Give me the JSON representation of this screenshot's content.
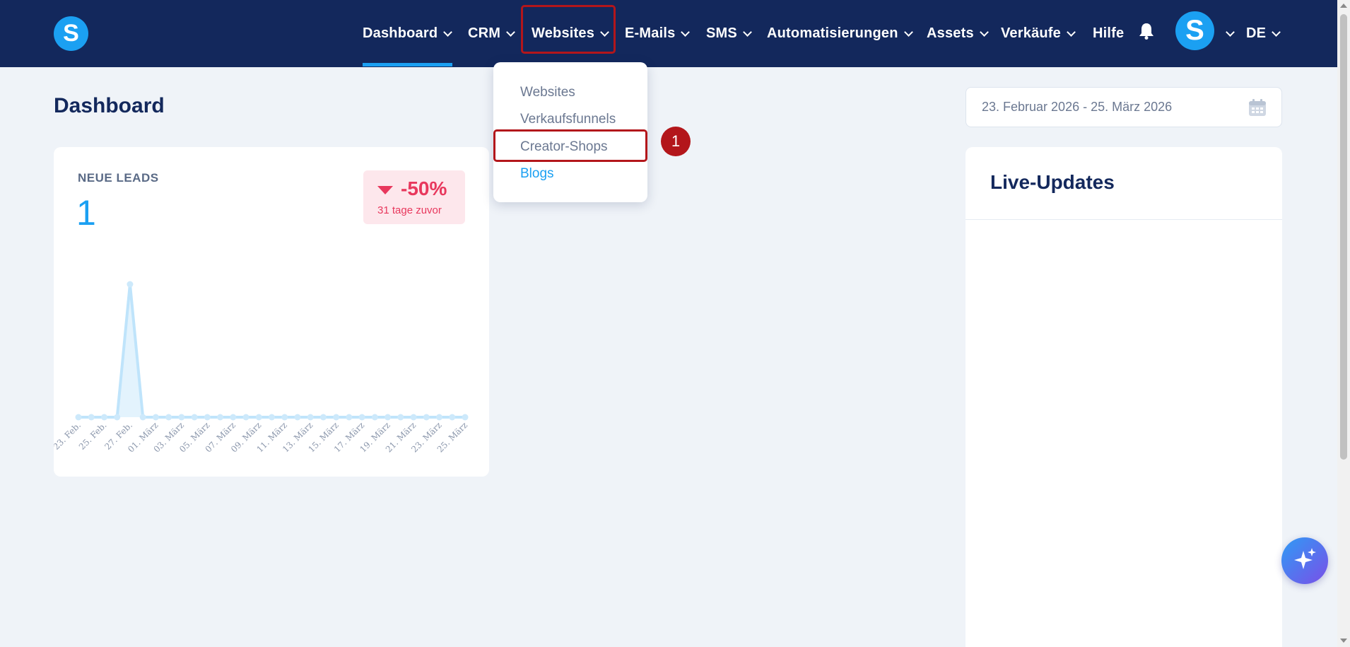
{
  "nav": {
    "logo_letter": "S",
    "items": [
      {
        "label": "Dashboard",
        "has_menu": true
      },
      {
        "label": "CRM",
        "has_menu": true
      },
      {
        "label": "Websites",
        "has_menu": true
      },
      {
        "label": "E-Mails",
        "has_menu": true
      },
      {
        "label": "SMS",
        "has_menu": true
      },
      {
        "label": "Automatisierungen",
        "has_menu": true
      },
      {
        "label": "Assets",
        "has_menu": true
      },
      {
        "label": "Verkäufe",
        "has_menu": true
      },
      {
        "label": "Hilfe",
        "has_menu": false
      }
    ],
    "avatar_letter": "S",
    "language": "DE",
    "accent_color": "#1ba0f2",
    "nav_bg_color": "#13285c"
  },
  "page": {
    "title": "Dashboard",
    "date_range": "23. Februar 2026 - 25. März 2026"
  },
  "websites_menu": {
    "items": [
      "Websites",
      "Verkaufsfunnels",
      "Creator-Shops",
      "Blogs"
    ],
    "highlighted_item": "Creator-Shops",
    "active_item": "Blogs"
  },
  "step_badge": "1",
  "leads_card": {
    "label": "NEUE LEADS",
    "value": "1",
    "change_pct": "-50%",
    "change_caption": "31 tage zuvor",
    "negative_color": "#e8385d"
  },
  "live_updates": {
    "title": "Live-Updates"
  },
  "chart_data": {
    "type": "area",
    "x": [
      "23. Feb.",
      "24. Feb.",
      "25. Feb.",
      "26. Feb.",
      "27. Feb.",
      "28. Feb.",
      "01. März",
      "02. März",
      "03. März",
      "04. März",
      "05. März",
      "06. März",
      "07. März",
      "08. März",
      "09. März",
      "10. März",
      "11. März",
      "12. März",
      "13. März",
      "14. März",
      "15. März",
      "16. März",
      "17. März",
      "18. März",
      "19. März",
      "20. März",
      "21. März",
      "22. März",
      "23. März",
      "24. März",
      "25. März"
    ],
    "tick_labels": [
      "23. Feb.",
      "25. Feb.",
      "27. Feb.",
      "01. März",
      "03. März",
      "05. März",
      "07. März",
      "09. März",
      "11. März",
      "13. März",
      "15. März",
      "17. März",
      "19. März",
      "21. März",
      "23. März",
      "25. März"
    ],
    "series": [
      {
        "values": [
          0,
          0,
          0,
          0,
          1,
          0,
          0,
          0,
          0,
          0,
          0,
          0,
          0,
          0,
          0,
          0,
          0,
          0,
          0,
          0,
          0,
          0,
          0,
          0,
          0,
          0,
          0,
          0,
          0,
          0,
          0
        ]
      }
    ],
    "ylim": [
      0,
      1
    ],
    "grid": false,
    "color": "#bfe4fb"
  }
}
